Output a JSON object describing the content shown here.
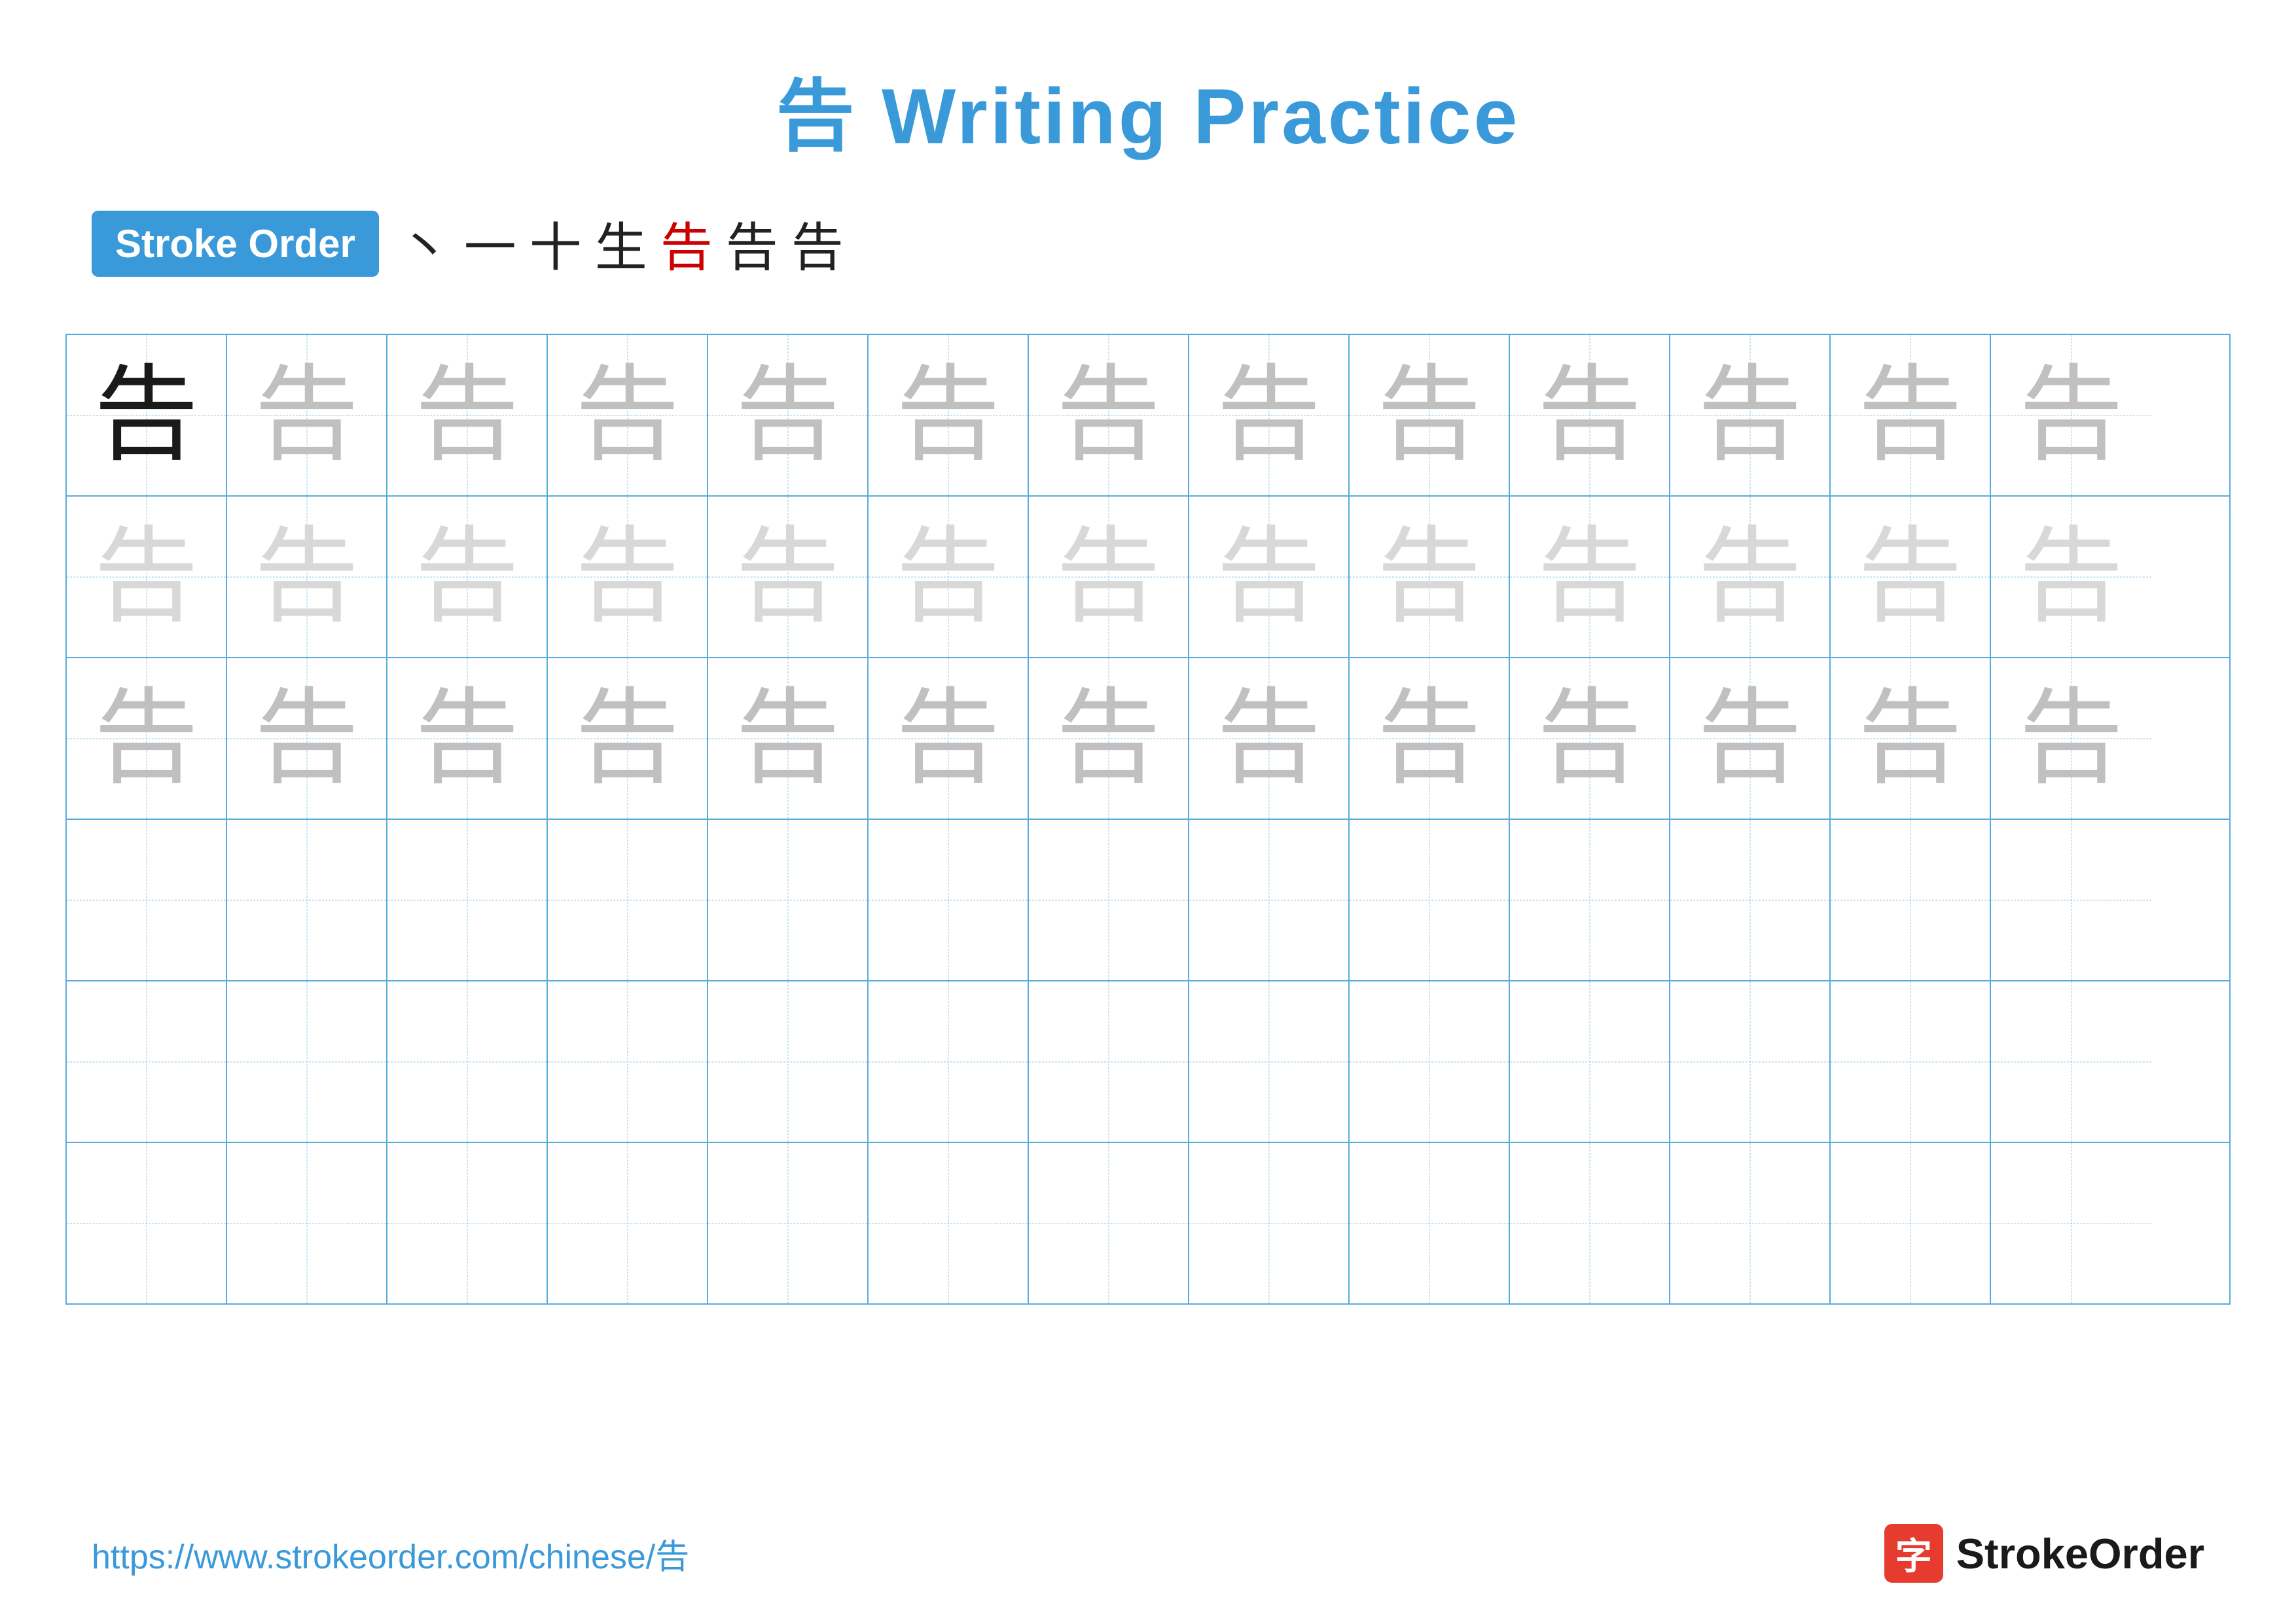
{
  "title": {
    "char": "告",
    "text": " Writing Practice"
  },
  "stroke_order": {
    "badge_label": "Stroke Order",
    "strokes": [
      "丶",
      "一",
      "十",
      "生",
      "告",
      "告",
      "告"
    ]
  },
  "grid": {
    "rows": 6,
    "cols": 13,
    "character": "告",
    "row_styles": [
      [
        "dark",
        "medium",
        "medium",
        "medium",
        "medium",
        "medium",
        "medium",
        "medium",
        "medium",
        "medium",
        "medium",
        "medium",
        "medium"
      ],
      [
        "light",
        "light",
        "light",
        "light",
        "light",
        "light",
        "light",
        "light",
        "light",
        "light",
        "light",
        "light",
        "light"
      ],
      [
        "medium",
        "medium",
        "medium",
        "medium",
        "medium",
        "medium",
        "medium",
        "medium",
        "medium",
        "medium",
        "medium",
        "medium",
        "medium"
      ],
      [
        "empty",
        "empty",
        "empty",
        "empty",
        "empty",
        "empty",
        "empty",
        "empty",
        "empty",
        "empty",
        "empty",
        "empty",
        "empty"
      ],
      [
        "empty",
        "empty",
        "empty",
        "empty",
        "empty",
        "empty",
        "empty",
        "empty",
        "empty",
        "empty",
        "empty",
        "empty",
        "empty"
      ],
      [
        "empty",
        "empty",
        "empty",
        "empty",
        "empty",
        "empty",
        "empty",
        "empty",
        "empty",
        "empty",
        "empty",
        "empty",
        "empty"
      ]
    ]
  },
  "footer": {
    "url": "https://www.strokeorder.com/chinese/告",
    "logo_char": "字",
    "logo_text": "StrokeOrder"
  }
}
